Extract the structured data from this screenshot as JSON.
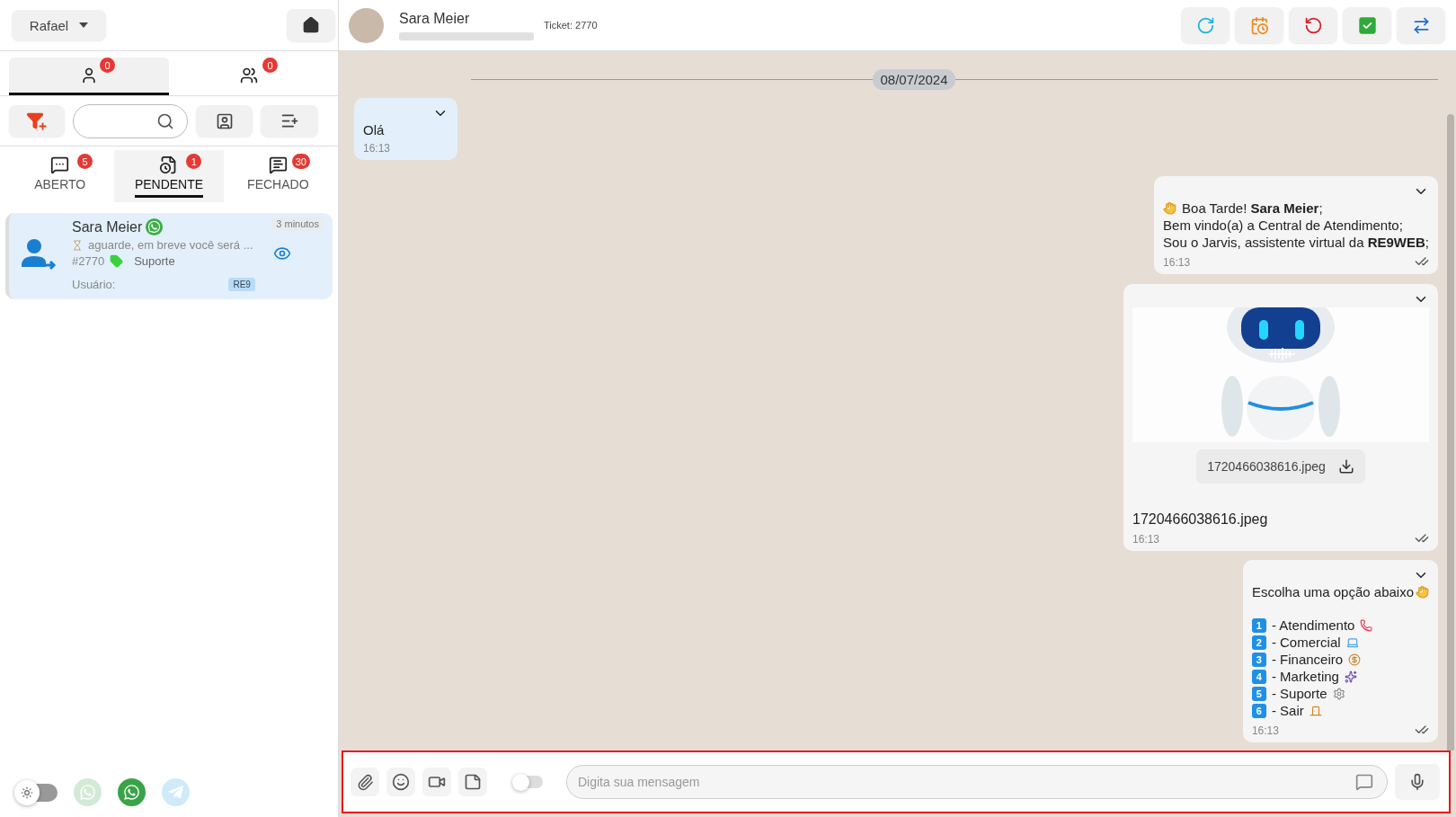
{
  "sidebar": {
    "user_menu": {
      "label": "Rafael"
    },
    "view_tabs": [
      {
        "badge": "0",
        "selected": true
      },
      {
        "badge": "0",
        "selected": false
      }
    ],
    "status_tabs": [
      {
        "label": "ABERTO",
        "badge": "5",
        "selected": false
      },
      {
        "label": "PENDENTE",
        "badge": "1",
        "selected": true
      },
      {
        "label": "FECHADO",
        "badge": "30",
        "selected": false
      }
    ],
    "tickets": [
      {
        "name": "Sara Meier",
        "time": "3 minutos",
        "preview": "aguarde, em breve você será ...",
        "number": "#2770",
        "queue": "Suporte",
        "user_label": "Usuário:",
        "connection": "RE9",
        "selected": true
      }
    ],
    "theme_toggle": {
      "on": false
    },
    "channels": [
      {
        "kind": "whatsapp",
        "active": false
      },
      {
        "kind": "whatsapp",
        "active": true
      },
      {
        "kind": "telegram",
        "active": false
      }
    ]
  },
  "chat": {
    "contact": {
      "name": "Sara Meier",
      "ticket": "Ticket: 2770"
    },
    "date": "08/07/2024",
    "messages": [
      {
        "kind": "text",
        "outgoing": false,
        "lines": [
          "Olá"
        ],
        "time": "16:13"
      },
      {
        "kind": "greeting",
        "outgoing": true,
        "lines": [
          "Boa Tarde! **Sara Meier**;",
          "Bem vindo(a) a Central de Atendimento;",
          "Sou o Jarvis, assistente virtual da **RE9WEB**;"
        ],
        "time": "16:13"
      },
      {
        "kind": "image",
        "outgoing": true,
        "file": "1720466038616.jpeg",
        "caption": "1720466038616.jpeg",
        "time": "16:13"
      },
      {
        "kind": "menu",
        "outgoing": true,
        "title": "Escolha uma opção abaixo",
        "options": [
          {
            "number": "1",
            "label": "- Atendimento"
          },
          {
            "number": "2",
            "label": "- Comercial"
          },
          {
            "number": "3",
            "label": "- Financeiro"
          },
          {
            "number": "4",
            "label": "- Marketing"
          },
          {
            "number": "5",
            "label": "- Suporte"
          },
          {
            "number": "6",
            "label": "- Sair"
          }
        ],
        "time": "16:13"
      }
    ]
  },
  "composer": {
    "toggle_on": false,
    "placeholder": "Digita sua mensagem"
  }
}
